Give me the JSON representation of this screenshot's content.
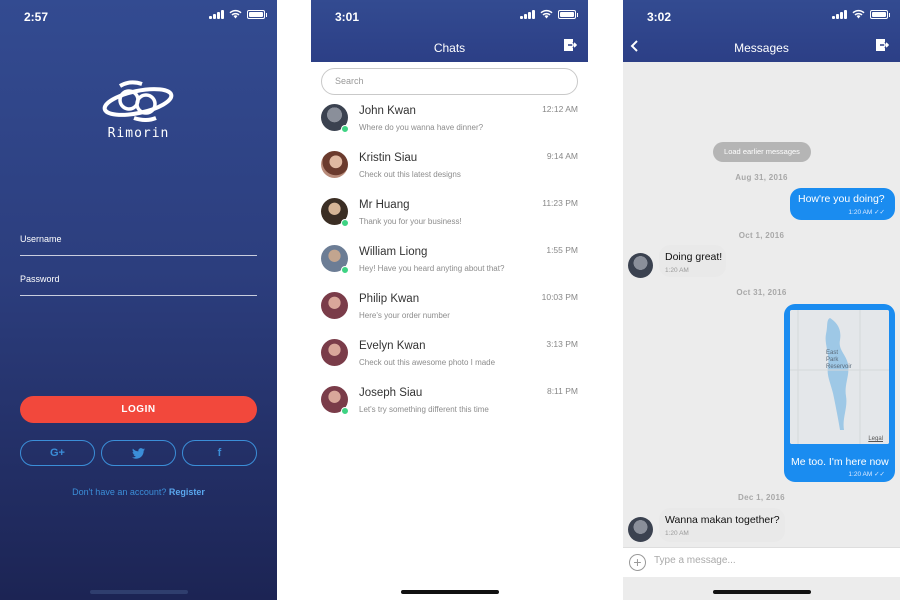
{
  "login": {
    "status_time": "2:57",
    "brand": "Rimorin",
    "username_label": "Username",
    "password_label": "Password",
    "login_button": "LOGIN",
    "social": {
      "google": "G+",
      "twitter": "twitter-icon",
      "facebook": "f"
    },
    "register_prompt": "Don't have an account?",
    "register_link": "Register"
  },
  "chats": {
    "status_time": "3:01",
    "title": "Chats",
    "search_placeholder": "Search",
    "items": [
      {
        "name": "John Kwan",
        "preview": "Where do you wanna have dinner?",
        "time": "12:12 AM",
        "online": true
      },
      {
        "name": "Kristin Siau",
        "preview": "Check out this latest designs",
        "time": "9:14 AM",
        "online": false
      },
      {
        "name": "Mr Huang",
        "preview": "Thank you for your business!",
        "time": "11:23 PM",
        "online": true
      },
      {
        "name": "William Liong",
        "preview": "Hey! Have you heard anyting about that?",
        "time": "1:55 PM",
        "online": true
      },
      {
        "name": "Philip Kwan",
        "preview": "Here's your order number",
        "time": "10:03 PM",
        "online": false
      },
      {
        "name": "Evelyn Kwan",
        "preview": "Check out this awesome photo I made",
        "time": "3:13 PM",
        "online": false
      },
      {
        "name": "Joseph Siau",
        "preview": "Let's try something different this time",
        "time": "8:11 PM",
        "online": true
      }
    ]
  },
  "messages": {
    "status_time": "3:02",
    "title": "Messages",
    "load_earlier": "Load earlier messages",
    "date1": "Aug 31, 2016",
    "msg1": {
      "text": "How're you doing?",
      "time": "1:20 AM"
    },
    "date2": "Oct 1, 2016",
    "msg2": {
      "text": "Doing great!",
      "time": "1:20 AM"
    },
    "date3": "Oct 31, 2016",
    "map": {
      "label1": "East",
      "label2": "Park",
      "label3": "Reservoir",
      "legal": "Legal"
    },
    "msg3": {
      "text": "Me too. I'm here now",
      "time": "1:20 AM"
    },
    "date4": "Dec 1, 2016",
    "msg4": {
      "text": "Wanna makan together?",
      "time": "1:20 AM"
    },
    "composer_placeholder": "Type a message..."
  },
  "colors": {
    "nav_blue": "#2c3f86",
    "login_red": "#f2483c",
    "bubble_blue": "#1a8cf0",
    "online_green": "#3ed383"
  }
}
